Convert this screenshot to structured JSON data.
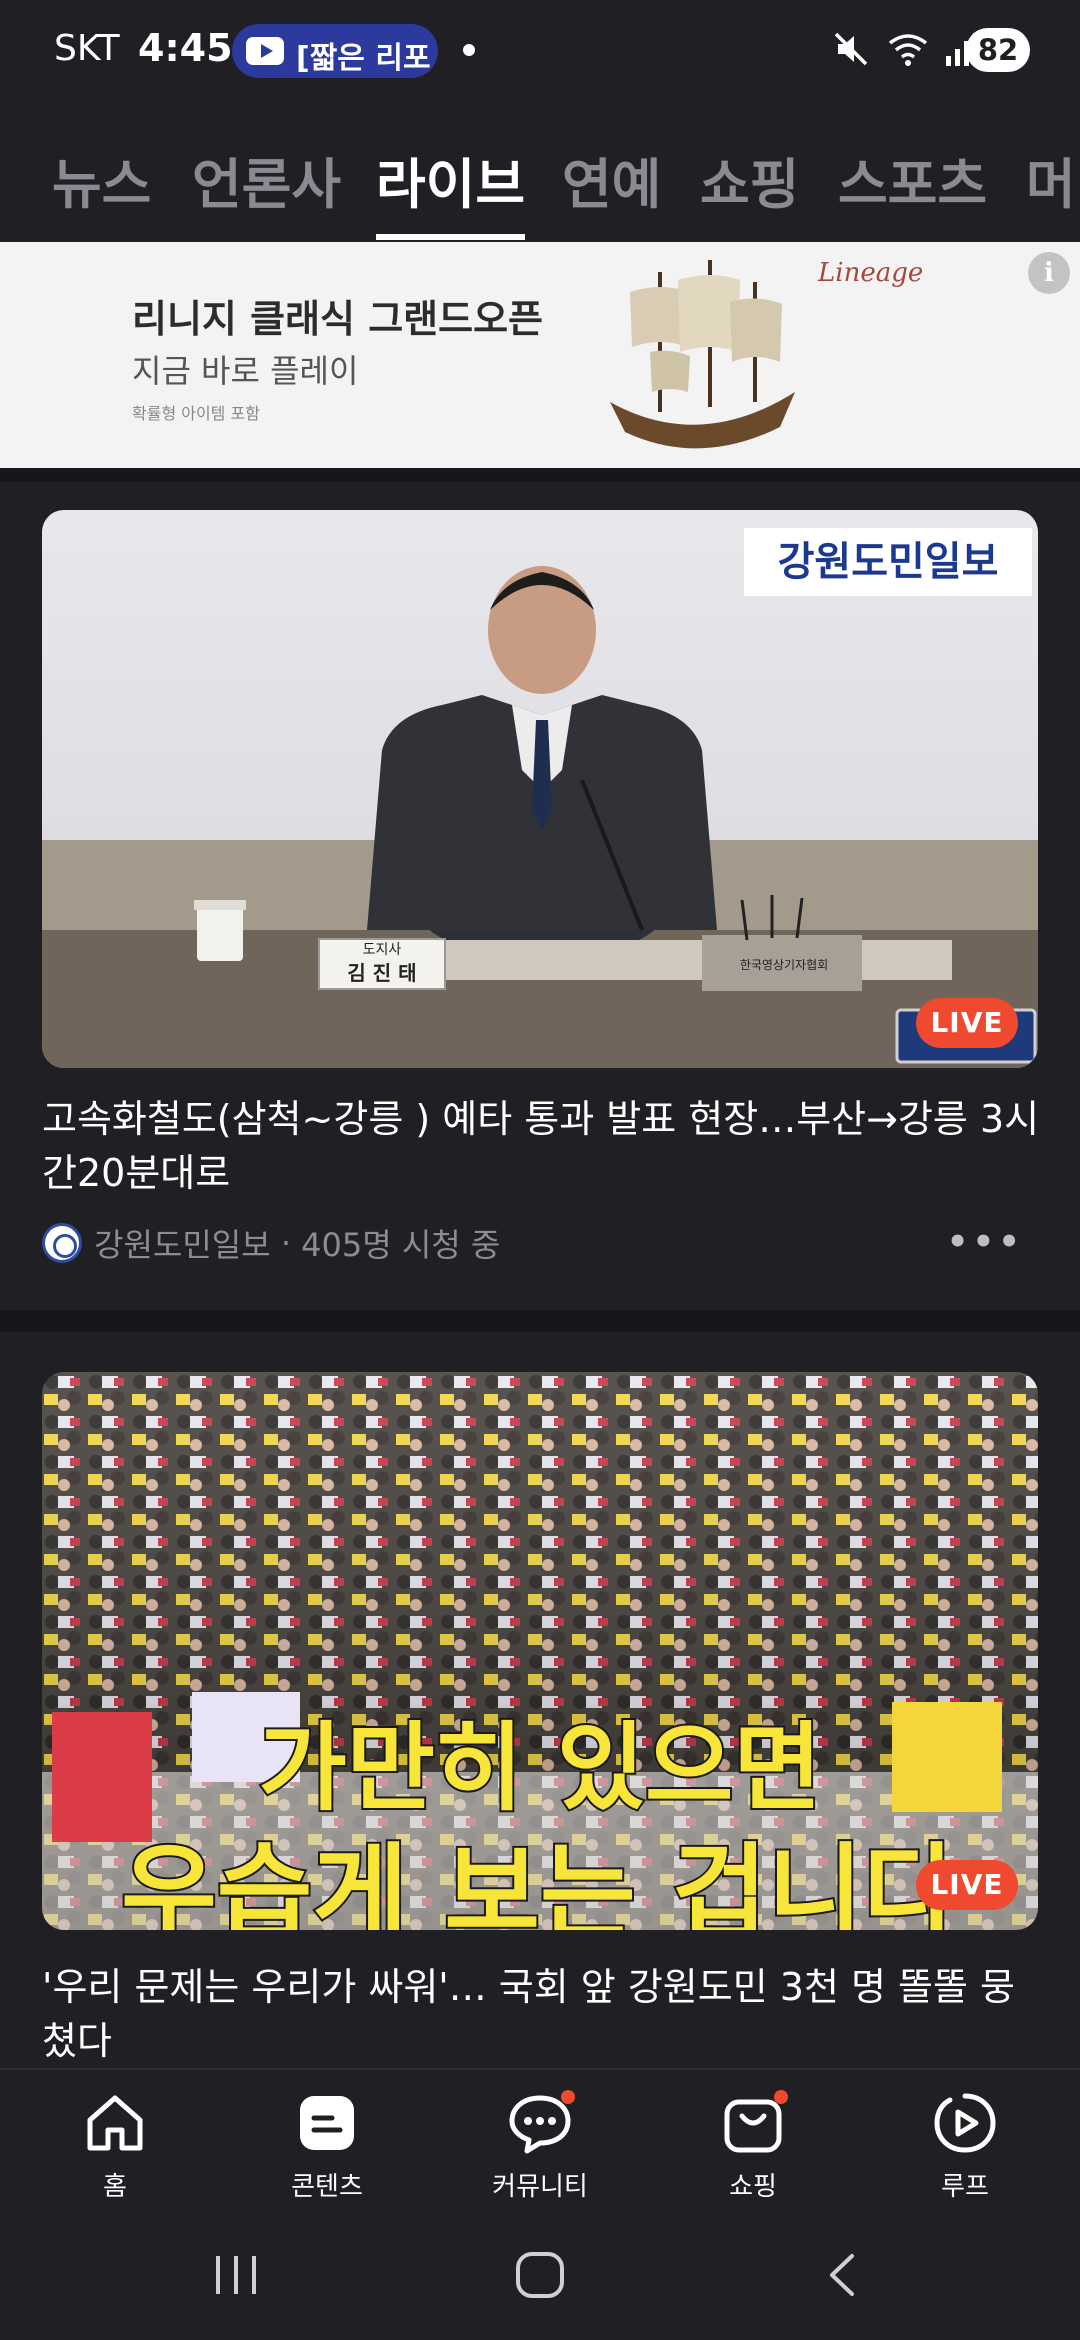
{
  "status_bar": {
    "carrier": "SKT",
    "time": "4:45",
    "pill_text": "[짧은 리포",
    "battery": "82"
  },
  "tabs": [
    {
      "label": "뉴스"
    },
    {
      "label": "언론사"
    },
    {
      "label": "라이브"
    },
    {
      "label": "연예"
    },
    {
      "label": "쇼핑"
    },
    {
      "label": "스포츠"
    },
    {
      "label": "머니"
    }
  ],
  "ad": {
    "title": "리니지 클래식 그랜드오픈",
    "subtitle": "지금 바로 플레이",
    "note": "확률형 아이템 포함",
    "logo_text": "Lineage",
    "info_glyph": "i"
  },
  "feed": [
    {
      "title": "고속화철도(삼척~강릉 ) 예타 통과 발표 현장…부산→강릉 3시간20분대로",
      "channel": "강원도민일보",
      "viewers": "405명 시청 중",
      "badge": "LIVE",
      "thumb_logo": "강원도민일보",
      "nameplate_title": "도지사",
      "nameplate_name": "김 진 태",
      "desk_sign": "한국영상기자협회"
    },
    {
      "title": "'우리 문제는 우리가 싸워'… 국회 앞 강원도민 3천 명 똘똘 뭉쳤다",
      "badge": "LIVE",
      "caption_line1": "가만히 있으면",
      "caption_line2": "우습게 보는 겁니다"
    }
  ],
  "bottom_nav": [
    {
      "label": "홈",
      "icon": "home-icon"
    },
    {
      "label": "콘텐츠",
      "icon": "contents-icon"
    },
    {
      "label": "커뮤니티",
      "icon": "community-icon"
    },
    {
      "label": "쇼핑",
      "icon": "shopping-bag-icon"
    },
    {
      "label": "루프",
      "icon": "loop-icon"
    }
  ],
  "colors": {
    "background": "#1f1f24",
    "live": "#ef4a30",
    "accent_blue": "#2b3a9c"
  }
}
